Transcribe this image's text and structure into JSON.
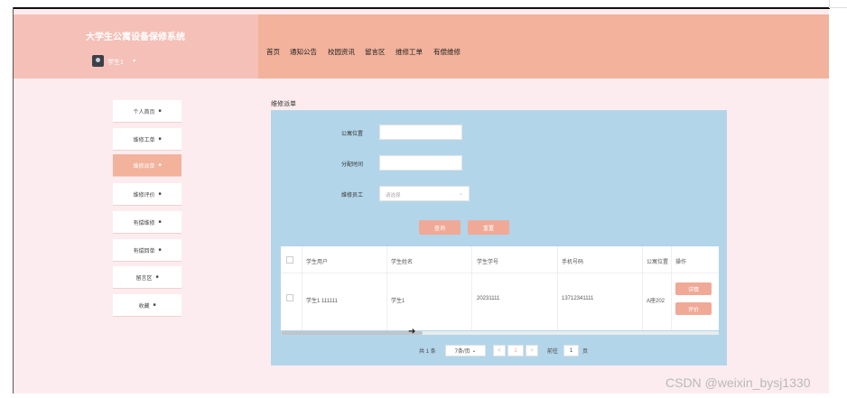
{
  "app": {
    "title": "大学生公寓设备保修系统",
    "user": "学生1"
  },
  "nav": [
    "首页",
    "通知公告",
    "校园资讯",
    "留言区",
    "维修工单",
    "有偿维修"
  ],
  "sidebar": [
    {
      "label": "个人首页"
    },
    {
      "label": "维修工单"
    },
    {
      "label": "维修派单"
    },
    {
      "label": "维修评价"
    },
    {
      "label": "有偿维修"
    },
    {
      "label": "有偿回单"
    },
    {
      "label": "留言区"
    },
    {
      "label": "收藏"
    }
  ],
  "breadcrumb": "维修派单",
  "form": {
    "apartment_label": "公寓位置",
    "apartment_value": "",
    "time_label": "分配时间",
    "time_value": "",
    "staff_label": "维修员工",
    "staff_placeholder": "请选择",
    "query_button": "查询",
    "reset_button": "重置"
  },
  "table": {
    "headers": [
      "学生用户",
      "学生姓名",
      "学生学号",
      "手机号码",
      "公寓位置",
      "操作"
    ],
    "rows": [
      {
        "user": "学生1 111111",
        "name": "学生1",
        "student_no": "20231111",
        "phone": "13712341111",
        "apartment": "A座202",
        "actions": [
          "详情",
          "评价"
        ]
      }
    ]
  },
  "pagination": {
    "total": "共 1 条",
    "page_size": "7条/页",
    "prev": "<",
    "page": "1",
    "next": ">",
    "goto_label": "前往",
    "goto_value": "1",
    "goto_suffix": "页"
  },
  "watermark": "CSDN @weixin_bysj1330"
}
